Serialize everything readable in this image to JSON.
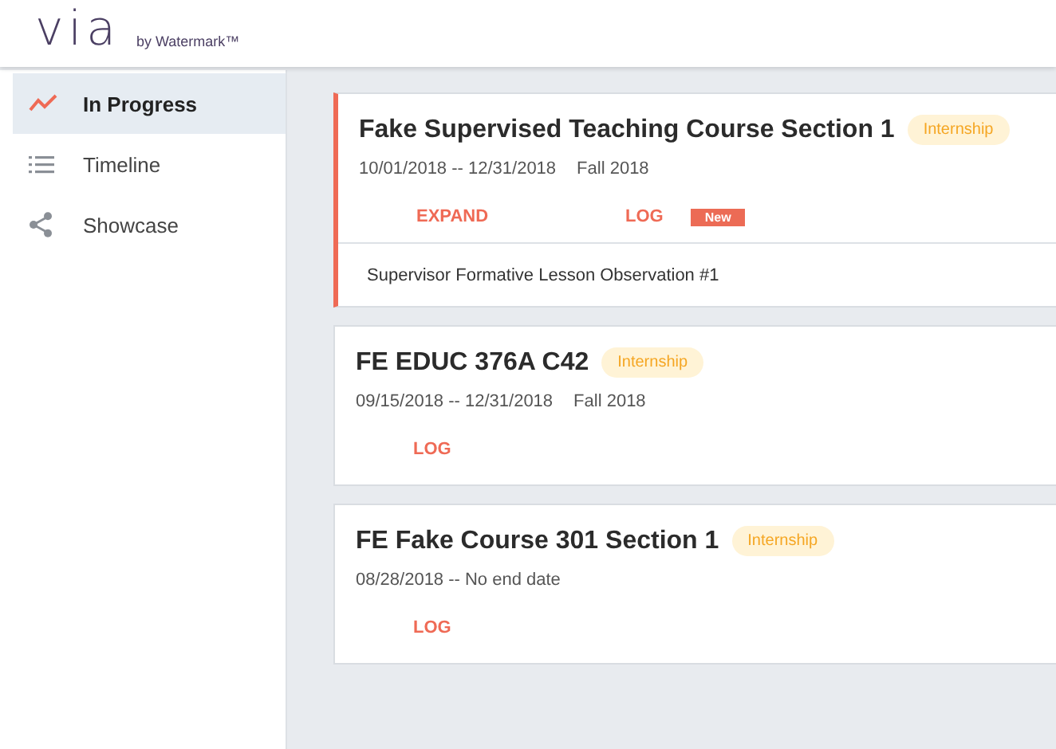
{
  "logo": {
    "wordmark": "via",
    "byline": "by Watermark™"
  },
  "sidebar": {
    "items": [
      {
        "label": "In Progress",
        "selected": true
      },
      {
        "label": "Timeline",
        "selected": false
      },
      {
        "label": "Showcase",
        "selected": false
      }
    ]
  },
  "cards": [
    {
      "title": "Fake Supervised Teaching Course Section 1",
      "tag": "Internship",
      "dates": "10/01/2018 -- 12/31/2018",
      "term": "Fall 2018",
      "selected": true,
      "actions": [
        {
          "label": "EXPAND"
        },
        {
          "label": "LOG",
          "badge": "New"
        }
      ],
      "entries": [
        "Supervisor Formative Lesson Observation #1"
      ]
    },
    {
      "title": "FE EDUC 376A C42",
      "tag": "Internship",
      "dates": "09/15/2018 -- 12/31/2018",
      "term": "Fall 2018",
      "selected": false,
      "actions": [
        {
          "label": "LOG"
        }
      ]
    },
    {
      "title": "FE Fake Course 301 Section 1",
      "tag": "Internship",
      "dates": "08/28/2018 -- No end date",
      "selected": false,
      "actions": [
        {
          "label": "LOG"
        }
      ]
    }
  ]
}
